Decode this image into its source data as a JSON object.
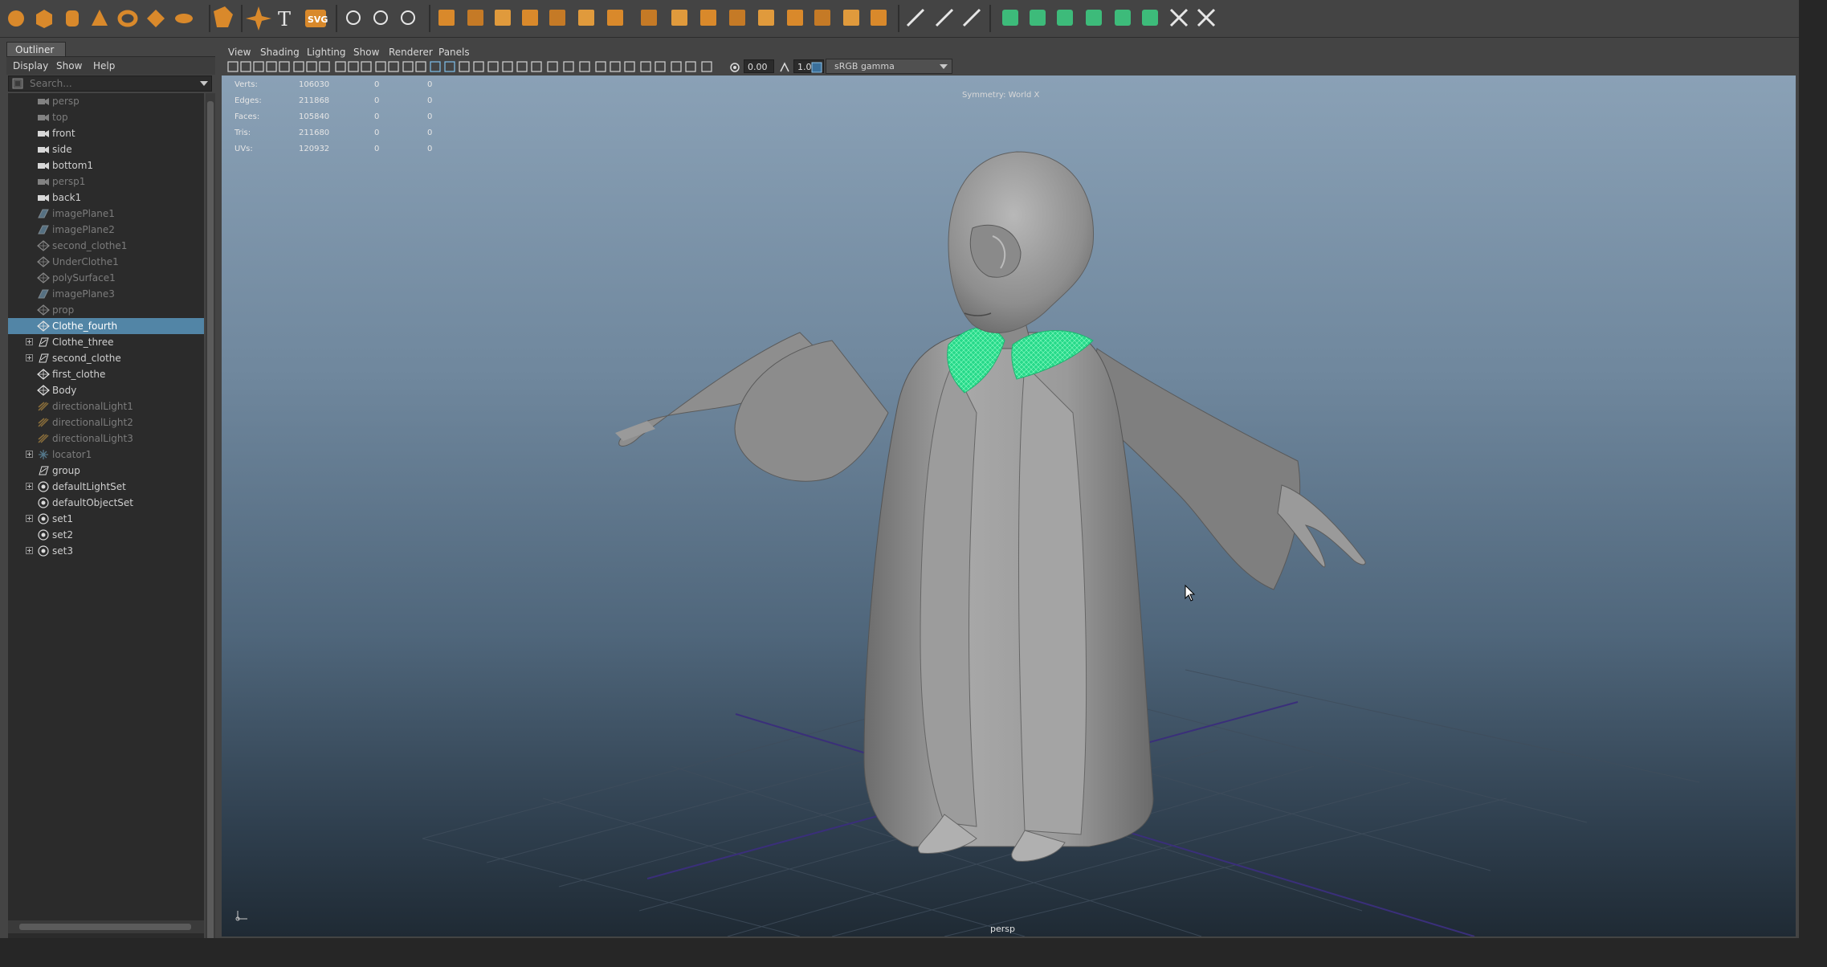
{
  "shelf": {
    "colors": {
      "orange": "#d9892b",
      "white": "#e6e6e6",
      "green": "#3dbb7a",
      "blue": "#4aa6d6"
    }
  },
  "outliner": {
    "tab_label": "Outliner",
    "menu": [
      "Display",
      "Show",
      "Help"
    ],
    "search_placeholder": "Search...",
    "items": [
      {
        "label": "persp",
        "icon": "camera-icon",
        "dim": true,
        "expand": false,
        "selected": false
      },
      {
        "label": "top",
        "icon": "camera-icon",
        "dim": true,
        "expand": false,
        "selected": false
      },
      {
        "label": "front",
        "icon": "camera-icon",
        "dim": false,
        "expand": false,
        "selected": false
      },
      {
        "label": "side",
        "icon": "camera-icon",
        "dim": false,
        "expand": false,
        "selected": false
      },
      {
        "label": "bottom1",
        "icon": "camera-icon",
        "dim": false,
        "expand": false,
        "selected": false
      },
      {
        "label": "persp1",
        "icon": "camera-icon",
        "dim": true,
        "expand": false,
        "selected": false
      },
      {
        "label": "back1",
        "icon": "camera-icon",
        "dim": false,
        "expand": false,
        "selected": false
      },
      {
        "label": "imagePlane1",
        "icon": "image-plane-icon",
        "dim": true,
        "expand": false,
        "selected": false
      },
      {
        "label": "imagePlane2",
        "icon": "image-plane-icon",
        "dim": true,
        "expand": false,
        "selected": false
      },
      {
        "label": "second_clothe1",
        "icon": "mesh-icon",
        "dim": true,
        "expand": false,
        "selected": false
      },
      {
        "label": "UnderClothe1",
        "icon": "mesh-icon",
        "dim": true,
        "expand": false,
        "selected": false
      },
      {
        "label": "polySurface1",
        "icon": "mesh-icon",
        "dim": true,
        "expand": false,
        "selected": false
      },
      {
        "label": "imagePlane3",
        "icon": "image-plane-icon",
        "dim": true,
        "expand": false,
        "selected": false
      },
      {
        "label": "prop",
        "icon": "mesh-icon",
        "dim": true,
        "expand": false,
        "selected": false
      },
      {
        "label": "Clothe_fourth",
        "icon": "mesh-icon",
        "dim": false,
        "expand": false,
        "selected": true
      },
      {
        "label": "Clothe_three",
        "icon": "group-icon",
        "dim": false,
        "expand": true,
        "selected": false
      },
      {
        "label": "second_clothe",
        "icon": "group-icon",
        "dim": false,
        "expand": true,
        "selected": false
      },
      {
        "label": "first_clothe",
        "icon": "mesh-icon",
        "dim": false,
        "expand": false,
        "selected": false
      },
      {
        "label": "Body",
        "icon": "mesh-icon",
        "dim": false,
        "expand": false,
        "selected": false
      },
      {
        "label": "directionalLight1",
        "icon": "directional-light-icon",
        "dim": true,
        "expand": false,
        "selected": false
      },
      {
        "label": "directionalLight2",
        "icon": "directional-light-icon",
        "dim": true,
        "expand": false,
        "selected": false
      },
      {
        "label": "directionalLight3",
        "icon": "directional-light-icon",
        "dim": true,
        "expand": false,
        "selected": false
      },
      {
        "label": "locator1",
        "icon": "locator-icon",
        "dim": true,
        "expand": true,
        "selected": false
      },
      {
        "label": "group",
        "icon": "group-icon",
        "dim": false,
        "expand": false,
        "selected": false
      },
      {
        "label": "defaultLightSet",
        "icon": "set-icon",
        "dim": false,
        "expand": true,
        "selected": false
      },
      {
        "label": "defaultObjectSet",
        "icon": "set-icon",
        "dim": false,
        "expand": false,
        "selected": false
      },
      {
        "label": "set1",
        "icon": "set-icon",
        "dim": false,
        "expand": true,
        "selected": false
      },
      {
        "label": "set2",
        "icon": "set-icon",
        "dim": false,
        "expand": false,
        "selected": false
      },
      {
        "label": "set3",
        "icon": "set-icon",
        "dim": false,
        "expand": true,
        "selected": false
      }
    ]
  },
  "viewport_menu": [
    "View",
    "Shading",
    "Lighting",
    "Show",
    "Renderer",
    "Panels"
  ],
  "viewport_toolbar": {
    "exposure": "0.00",
    "gamma": "1.00",
    "color_space": "sRGB gamma"
  },
  "hud": {
    "rows": [
      {
        "label": "Verts:",
        "value": "106030",
        "a": "0",
        "b": "0"
      },
      {
        "label": "Edges:",
        "value": "211868",
        "a": "0",
        "b": "0"
      },
      {
        "label": "Faces:",
        "value": "105840",
        "a": "0",
        "b": "0"
      },
      {
        "label": "Tris:",
        "value": "211680",
        "a": "0",
        "b": "0"
      },
      {
        "label": "UVs:",
        "value": "120932",
        "a": "0",
        "b": "0"
      }
    ],
    "symmetry": "Symmetry: World X",
    "camera": "persp"
  }
}
